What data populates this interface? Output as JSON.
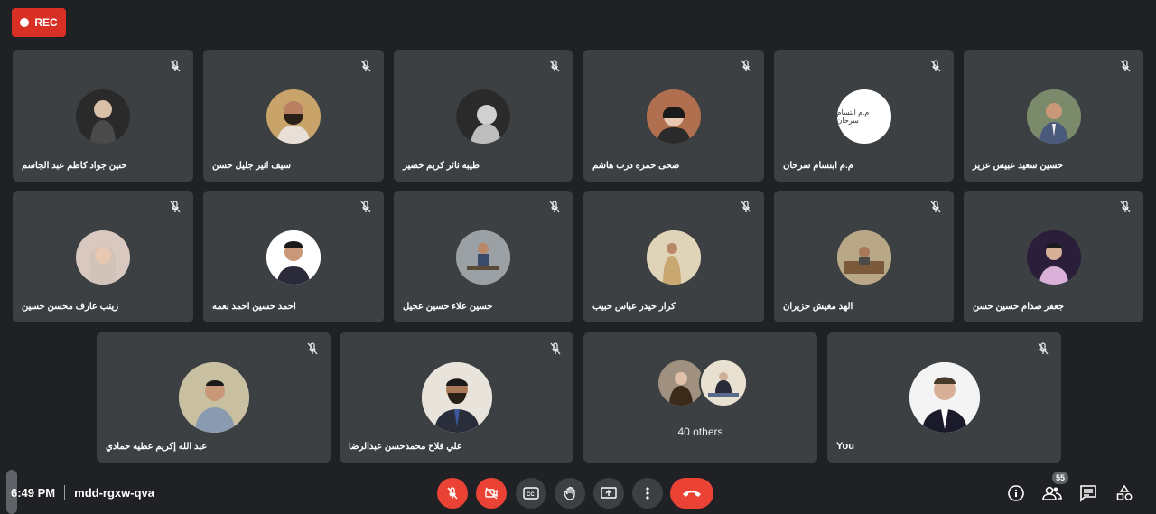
{
  "recording": {
    "label": "REC"
  },
  "meeting": {
    "time": "6:49 PM",
    "code": "mdd-rgxw-qva"
  },
  "participants_count": "55",
  "row1": [
    {
      "name": "حنين جواد كاظم عبد الجاسم",
      "avatar_color": "#2a2a2a"
    },
    {
      "name": "سيف اثير جليل حسن",
      "avatar_color": "#c9a46a"
    },
    {
      "name": "طيبه ثائر كريم خضير",
      "avatar_color": "#7a7a7a"
    },
    {
      "name": "ضحى حمزه درب هاشم",
      "avatar_color": "#8a5a3a"
    },
    {
      "name": "م.م ابتسام سرحان",
      "avatar_color": "#ffffff",
      "avatar_text": "م.م ابتسام سرحان"
    },
    {
      "name": "حسين سعيد عبيس عزيز",
      "avatar_color": "#6a7a8a"
    }
  ],
  "row2": [
    {
      "name": "زينب عارف محسن حسين",
      "avatar_color": "#d8c8c0"
    },
    {
      "name": "احمد حسين احمد نعمه",
      "avatar_color": "#e0e0e0"
    },
    {
      "name": "حسين علاء حسين عجيل",
      "avatar_color": "#8a8f94"
    },
    {
      "name": "كرار حيدر عباس حبيب",
      "avatar_color": "#c8b898"
    },
    {
      "name": "الهد مغيش حزيران",
      "avatar_color": "#9a8a70"
    },
    {
      "name": "جعفر صدام حسين حسن",
      "avatar_color": "#3a2e4a"
    }
  ],
  "row3": [
    {
      "name": "عبد الله إكريم عطيه حمادي",
      "avatar_color": "#b8b098"
    },
    {
      "name": "علي فلاح محمدحسن عبدالرضا",
      "avatar_color": "#d8d4cc"
    },
    {
      "name": "40 others",
      "avatar_color": "#6a5a48"
    },
    {
      "name": "You",
      "avatar_color": "#e8e8e8"
    }
  ],
  "colors": {
    "background": "#202124",
    "tile": "#3c4043",
    "danger": "#ea4335"
  }
}
